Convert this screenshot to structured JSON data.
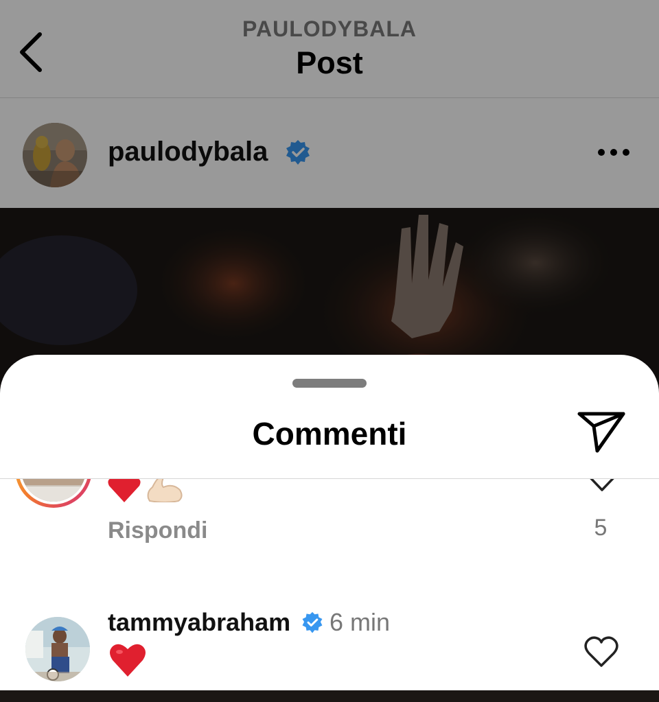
{
  "header": {
    "account": "PAULODYBALA",
    "title": "Post"
  },
  "post": {
    "author": "paulodybala",
    "verified": true
  },
  "comments_sheet": {
    "title": "Commenti",
    "comments": [
      {
        "text_emojis": [
          "red-heart",
          "flexed-biceps"
        ],
        "reply_label": "Rispondi",
        "likes": "5"
      },
      {
        "username": "tammyabraham",
        "verified": true,
        "time": "6 min",
        "text_emojis": [
          "red-heart"
        ]
      }
    ]
  },
  "colors": {
    "verified_blue": "#3897f0",
    "muted_text": "#8a8a8a",
    "heart_red": "#e0202f",
    "story_ring": [
      "#f9c33c",
      "#f27a2e",
      "#d42a78"
    ]
  },
  "icons": [
    "back-chevron-icon",
    "verified-badge-icon",
    "more-options-icon",
    "share-send-icon",
    "heart-outline-icon",
    "red-heart-emoji",
    "flexed-biceps-emoji"
  ]
}
